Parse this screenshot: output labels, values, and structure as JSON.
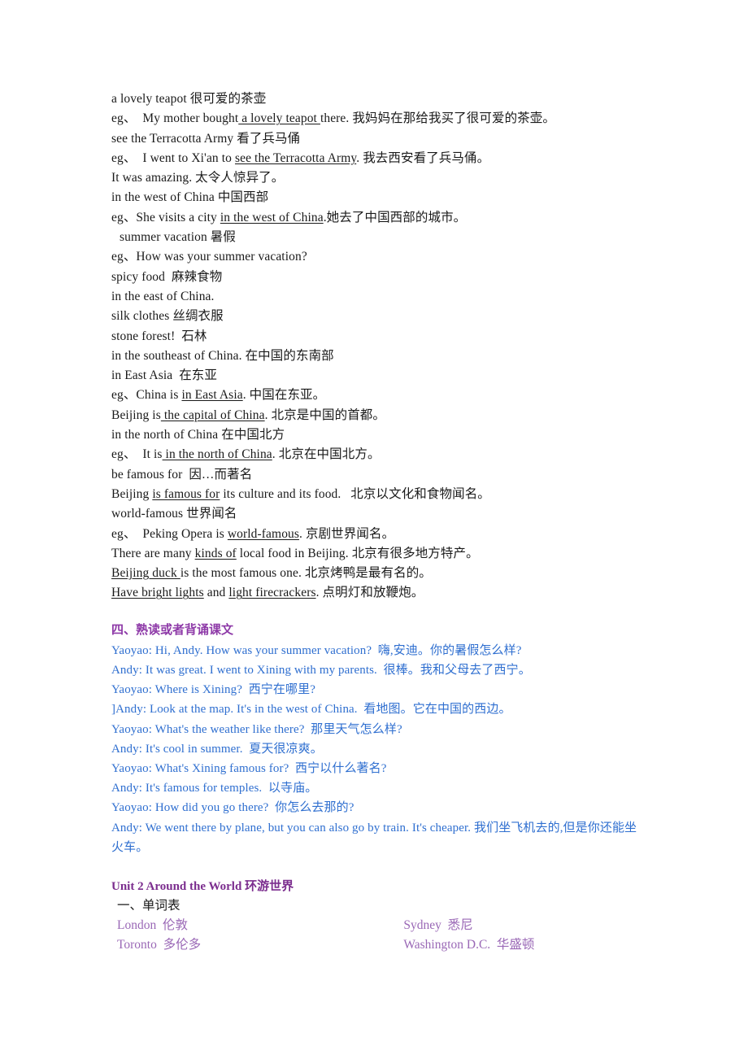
{
  "colors": {
    "body_text": "#1a1a1a",
    "section_heading": "#8e3aa8",
    "dialogue": "#2f6fd0",
    "unit_heading": "#7b2d8e",
    "wordlist": "#9a68b6",
    "background": "#ffffff"
  },
  "phrases": {
    "lines": [
      {
        "pre": "a lovely teapot 很可爱的茶壶",
        "u": "",
        "post": ""
      },
      {
        "pre": "eg、  My mother bought",
        "u": " a lovely teapot ",
        "post": "there. 我妈妈在那给我买了很可爱的茶壶。"
      },
      {
        "pre": "see the Terracotta Army 看了兵马俑",
        "u": "",
        "post": ""
      },
      {
        "pre": "eg、  I went to Xi'an to ",
        "u": "see the Terracotta Army",
        "post": ". 我去西安看了兵马俑。"
      },
      {
        "pre": "It was amazing. 太令人惊异了。",
        "u": "",
        "post": ""
      },
      {
        "pre": "in the west of China 中国西部",
        "u": "",
        "post": ""
      },
      {
        "pre": "eg、She visits a city ",
        "u": "in the west of China",
        "post": ".她去了中国西部的城市。"
      },
      {
        "pre": " summer vacation 暑假",
        "u": "",
        "post": "",
        "indent": true
      },
      {
        "pre": "eg、How was your summer vacation?",
        "u": "",
        "post": ""
      },
      {
        "pre": "spicy food  麻辣食物",
        "u": "",
        "post": ""
      },
      {
        "pre": "in the east of China.",
        "u": "",
        "post": ""
      },
      {
        "pre": "silk clothes 丝绸衣服",
        "u": "",
        "post": ""
      },
      {
        "pre": "stone forest!  石林",
        "u": "",
        "post": ""
      },
      {
        "pre": "in the southeast of China. 在中国的东南部",
        "u": "",
        "post": ""
      },
      {
        "pre": "in East Asia  在东亚",
        "u": "",
        "post": ""
      },
      {
        "pre": "eg、China is ",
        "u": "in East Asia",
        "post": ". 中国在东亚。"
      },
      {
        "pre": "Beijing is",
        "u": " the capital of China",
        "post": ". 北京是中国的首都。"
      },
      {
        "pre": "in the north of China 在中国北方",
        "u": "",
        "post": ""
      },
      {
        "pre": "eg、  It is",
        "u": " in the north of China",
        "post": ". 北京在中国北方。"
      },
      {
        "pre": "be famous for  因…而著名",
        "u": "",
        "post": ""
      },
      {
        "pre": "Beijing ",
        "u": "is famous for",
        "post": " its culture and its food.   北京以文化和食物闻名。"
      },
      {
        "pre": "world-famous 世界闻名",
        "u": "",
        "post": ""
      },
      {
        "pre": "eg、  Peking Opera is ",
        "u": "world-famous",
        "post": ". 京剧世界闻名。"
      },
      {
        "pre": "There are many ",
        "u": "kinds of",
        "post": " local food in Beijing. 北京有很多地方特产。"
      },
      {
        "pre": "",
        "u": "Beijing duck ",
        "post": "is the most famous one. 北京烤鸭是最有名的。"
      },
      {
        "pre": "",
        "u": "Have bright lights",
        "post": " and ",
        "u2": "light firecrackers",
        "post2": ". 点明灯和放鞭炮。"
      }
    ]
  },
  "section": {
    "heading": "四、熟读或者背诵课文",
    "dialogue": [
      "Yaoyao: Hi, Andy. How was your summer vacation?  嗨,安迪。你的暑假怎么样?",
      "Andy: It was great. I went to Xining with my parents.  很棒。我和父母去了西宁。",
      "Yaoyao: Where is Xining?  西宁在哪里?",
      "]Andy: Look at the map. It's in the west of China.  看地图。它在中国的西边。",
      "Yaoyao: What's the weather like there?  那里天气怎么样?",
      "Andy: It's cool in summer.  夏天很凉爽。",
      "Yaoyao: What's Xining famous for?  西宁以什么著名?",
      "Andy: It's famous for temples.  以寺庙。",
      "Yaoyao: How did you go there?  你怎么去那的?",
      "Andy: We went there by plane, but you can also go by train. It's cheaper. 我们坐飞机去的,但是你还能坐火车。"
    ]
  },
  "unit2": {
    "heading": "Unit 2 Around the World  环游世界",
    "subheading": "一、单词表",
    "words": [
      {
        "col1": "London  伦敦",
        "col2": "Sydney  悉尼"
      },
      {
        "col1": "Toronto  多伦多",
        "col2": "Washington D.C.  华盛顿"
      }
    ]
  }
}
